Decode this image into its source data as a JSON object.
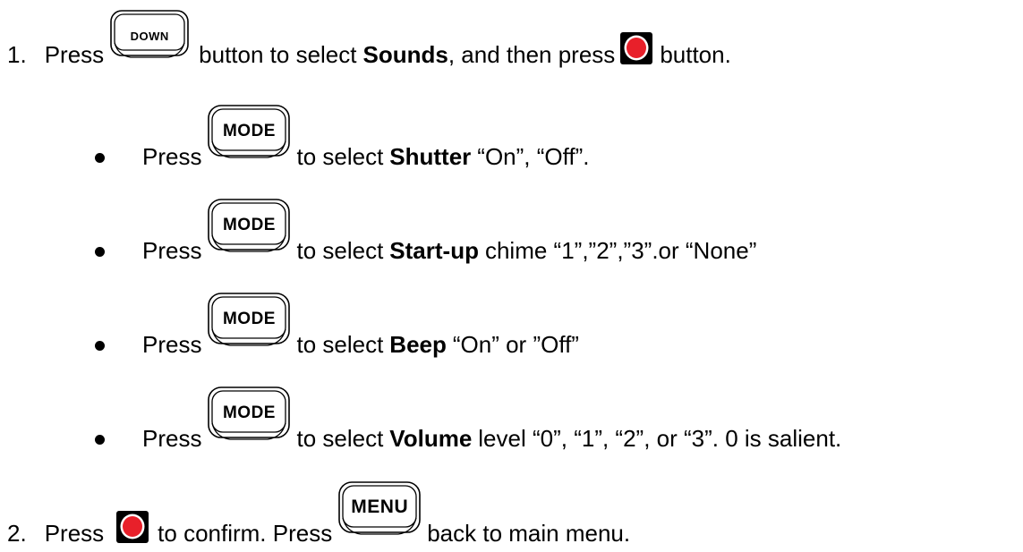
{
  "steps": [
    {
      "number": "1.",
      "press": "Press",
      "down_button_label": "DOWN",
      "text_a": "button to select",
      "target": "Sounds",
      "text_b": ", and then press",
      "text_c": "button."
    },
    {
      "number": "2.",
      "press": "Press",
      "text_a": "to confirm. Press",
      "menu_button_label": "MENU",
      "text_b": "back to main menu."
    }
  ],
  "bullets": [
    {
      "press": "Press",
      "button_label": "MODE",
      "pre": "to select",
      "setting": "Shutter",
      "post": "“On”, “Off”."
    },
    {
      "press": "Press",
      "button_label": "MODE",
      "pre": "to select",
      "setting": "Start-up",
      "post": "chime “1”,”2”,”3”.or “None”"
    },
    {
      "press": "Press",
      "button_label": "MODE",
      "pre": "to select",
      "setting": "Beep",
      "post": "“On” or ”Off”"
    },
    {
      "press": "Press",
      "button_label": "MODE",
      "pre": "to select",
      "setting": "Volume",
      "post": "level “0”, “1”, “2”, or “3”.  0 is salient."
    }
  ],
  "colors": {
    "ok_button_red": "#e8202a",
    "ok_button_bg": "#000000"
  },
  "icons": {
    "ok_button": "ok-record-button-icon",
    "oval_button": "oval-hardware-button-icon"
  }
}
